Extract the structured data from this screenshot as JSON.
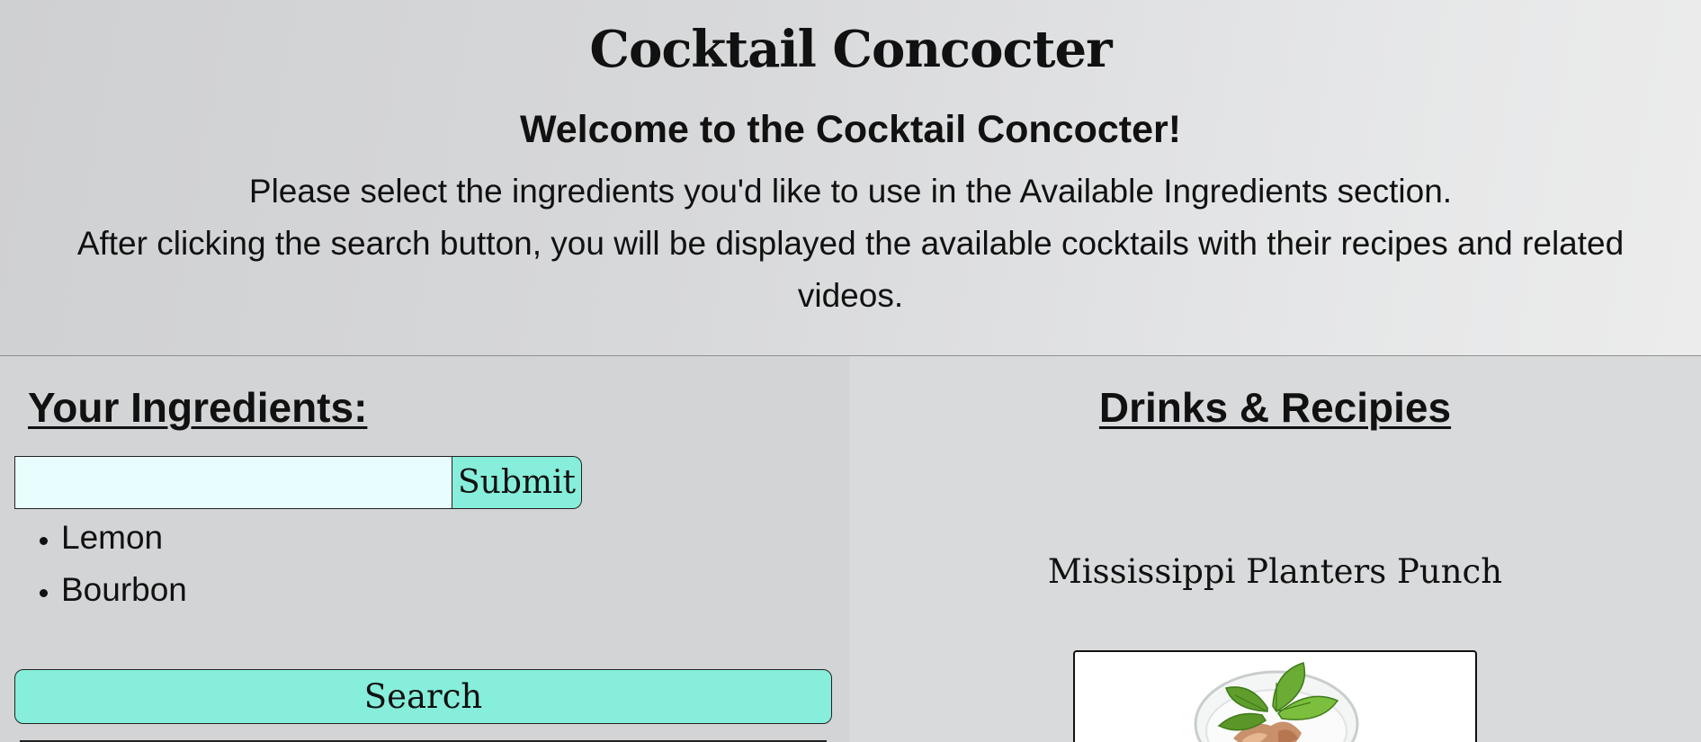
{
  "header": {
    "title": "Cocktail Concocter",
    "welcome": "Welcome to the Cocktail Concocter!",
    "intro_line1": "Please select the ingredients you'd like to use in the Available Ingredients section.",
    "intro_line2": "After clicking the search button, you will be displayed the available cocktails with their recipes and related videos."
  },
  "ingredients_panel": {
    "heading": "Your Ingredients:",
    "input_value": "",
    "submit_label": "Submit",
    "items": [
      "Lemon",
      "Bourbon"
    ],
    "search_label": "Search"
  },
  "drinks_panel": {
    "heading": "Drinks & Recipies",
    "drink_name": "Mississippi Planters Punch",
    "drink_image_icon": "cocktail-glass-with-mint"
  },
  "colors": {
    "button_accent": "#86eeda",
    "input_background": "#e8fdfd",
    "panel_background": "#d3d4d6"
  }
}
